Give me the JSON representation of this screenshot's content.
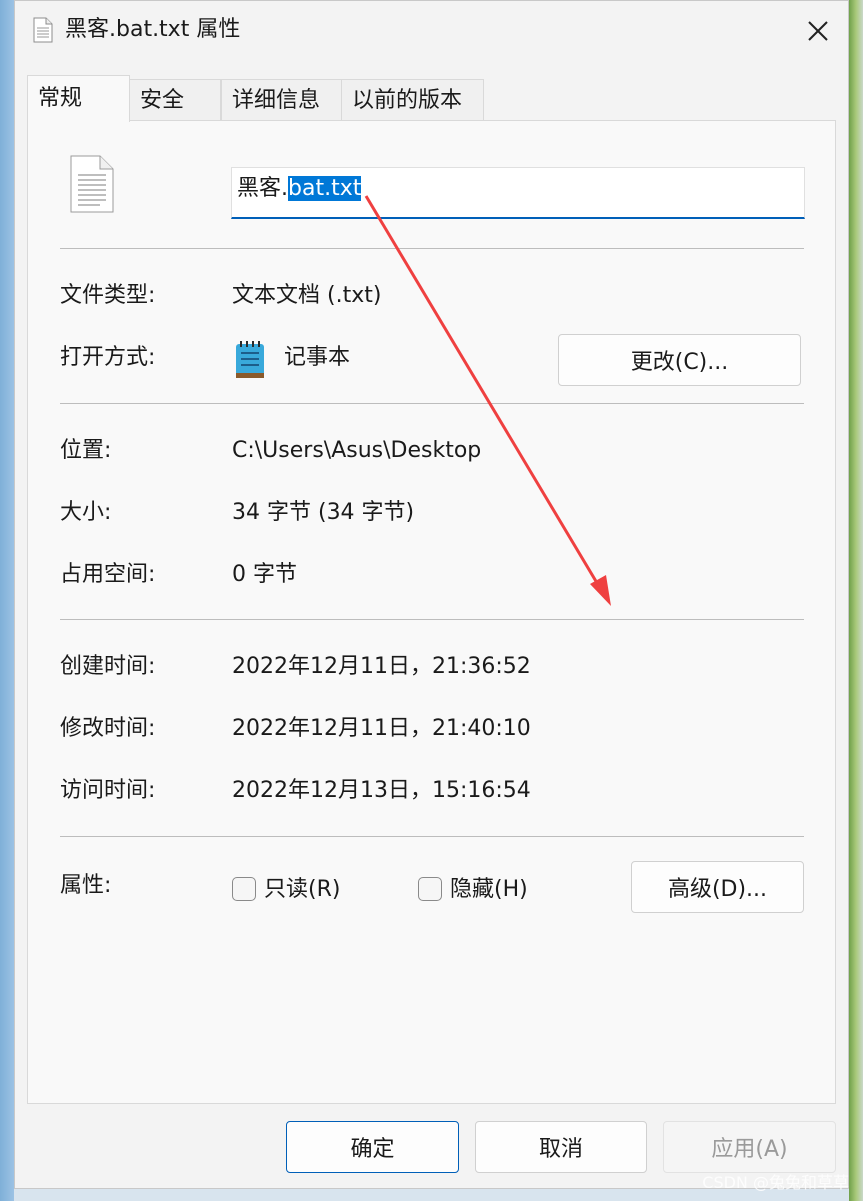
{
  "window": {
    "title": "黑客.bat.txt 属性",
    "close_icon": "close-icon"
  },
  "tabs": [
    {
      "label": "常规",
      "active": true
    },
    {
      "label": "安全",
      "active": false
    },
    {
      "label": "详细信息",
      "active": false
    },
    {
      "label": "以前的版本",
      "active": false
    }
  ],
  "general": {
    "file_icon": "text-file-icon",
    "file_name_unselected": "黑客.",
    "file_name_selected": "bat.txt",
    "file_type_label": "文件类型:",
    "file_type_value": "文本文档 (.txt)",
    "opens_with_label": "打开方式:",
    "opens_with_icon": "notepad-icon",
    "opens_with_value": "记事本",
    "change_button": "更改(C)...",
    "location_label": "位置:",
    "location_value": "C:\\Users\\Asus\\Desktop",
    "size_label": "大小:",
    "size_value": "34 字节 (34 字节)",
    "size_on_disk_label": "占用空间:",
    "size_on_disk_value": "0 字节",
    "created_label": "创建时间:",
    "created_value": "2022年12月11日，21:36:52",
    "modified_label": "修改时间:",
    "modified_value": "2022年12月11日，21:40:10",
    "accessed_label": "访问时间:",
    "accessed_value": "2022年12月13日，15:16:54",
    "attributes_label": "属性:",
    "readonly_label": "只读(R)",
    "readonly_checked": false,
    "hidden_label": "隐藏(H)",
    "hidden_checked": false,
    "advanced_button": "高级(D)..."
  },
  "footer": {
    "ok": "确定",
    "cancel": "取消",
    "apply": "应用(A)"
  },
  "watermark": "CSDN @兔兔和草草",
  "colors": {
    "accent": "#005fb8",
    "selection": "#0078d7",
    "annotation_arrow": "#ef4040"
  }
}
